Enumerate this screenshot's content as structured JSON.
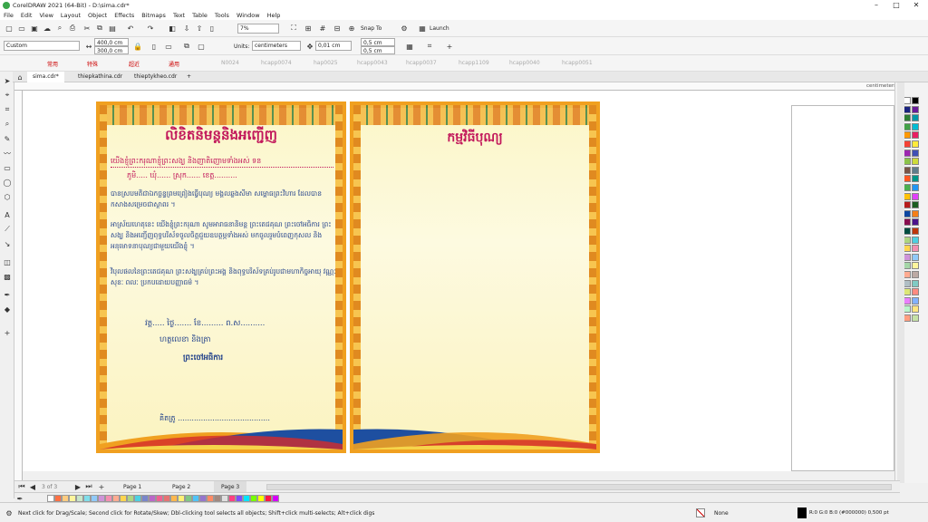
{
  "app": {
    "title": "CorelDRAW 2021 (64-Bit) - D:\\sima.cdr*"
  },
  "menu": [
    "File",
    "Edit",
    "View",
    "Layout",
    "Object",
    "Effects",
    "Bitmaps",
    "Text",
    "Table",
    "Tools",
    "Window",
    "Help"
  ],
  "toolbar": {
    "zoom": "7%",
    "snap_to": "Snap To",
    "launch": "Launch"
  },
  "propertybar": {
    "page_size": "Custom",
    "width": "400,0 cm",
    "height": "300,0 cm",
    "units_label": "Units:",
    "units": "centimeters",
    "nudge": "0,01 cm",
    "dup_x": "0,5 cm",
    "dup_y": "0,5 cm"
  },
  "fontbar": [
    "常用",
    "特殊",
    "超近",
    "通用"
  ],
  "fontbar_dim": [
    "N0024",
    "hcapp0074",
    "hap0025",
    "hcapp0043",
    "hcapp0037",
    "hcapp1109",
    "hcapp0040",
    "hcapp0051"
  ],
  "doc_tabs": [
    {
      "label": "sima.cdr*",
      "active": true
    },
    {
      "label": "thiepkathina.cdr",
      "active": false
    },
    {
      "label": "thieptykheo.cdr",
      "active": false
    }
  ],
  "ruler_unit": "centimeters",
  "left_page": {
    "title": "លិខិតនិមន្តនិងអញ្ជើញ",
    "line1": "យើងខ្ញុំព្រះករុណាខ្ញុំព្រះសង្ឃ និងញាតិញោមទាំងអស់ ទន",
    "line2": "ភូមិ..... ឃុំ...... ស្រុក...... ខេត្ត..........",
    "para1": "បានស្របមតិជាឯកច្ឆន្ទព្រមព្រៀងធ្វើបុណ្យ មង្គលឆ្លងសីមា សម្ពោធព្រះវិហារ ដែលបានកសាងសម្រេចជាស្ថាពរ ។",
    "para2": "អាស្រ័យហេតុនេះ យើងខ្ញុំព្រះករុណា សូមអារាធនានិមន្ត ព្រះតេជគុណ ព្រះចៅអធិការ ព្រះសង្ឃ និងអញ្ជើញពុទ្ធបរិស័ទចូលចិត្តជួយឧបត្ថម្ភទាំងអស់ មកចូលរួមបំពេញកុសល និងអនុមោទនាបុណ្យជាមួយយើងខ្ញុំ ។",
    "para3": "វិបុលផលនៃព្រះតេជគុណ ព្រះសង្ឃគ្រប់ព្រះអង្គ និងពុទ្ធបរិស័ទគ្រប់រូបជាមហាកិច្ចអាយុ វណ្ណៈ សុខៈ ពលៈ ប្រកបដោយបញ្ញាធម៌ ។",
    "date": "វត្ត..... ថ្ងៃ....... ខែ......... ព.ស..........",
    "place": "ហត្ថលេខា និងត្រា",
    "sign": "ព្រះចៅអធិការ",
    "bottom": "គិតត្រូ ........................................"
  },
  "right_page": {
    "title": "កម្មវិធីបុណ្យ"
  },
  "pages": {
    "counter": "3 of 3",
    "tabs": [
      {
        "label": "Page 1",
        "active": false
      },
      {
        "label": "Page 2",
        "active": false
      },
      {
        "label": "Page 3",
        "active": true
      }
    ]
  },
  "status": {
    "hint": "Next click for Drag/Scale; Second click for Rotate/Skew; Dbl-clicking tool selects all objects; Shift+click multi-selects; Alt+click digs",
    "fill": "None",
    "outline": "R:0 G:0 B:0 (#000000)  0,500 pt"
  },
  "colors": {
    "accent": "#3aa64a",
    "border": "#f0a020",
    "title_red": "#c2185b",
    "text_blue": "#1f3f8a"
  },
  "palette_right": [
    "#ffffff",
    "#000000",
    "#1a237e",
    "#6a1b9a",
    "#2e7d32",
    "#0097a7",
    "#43a047",
    "#00bcd4",
    "#ff9800",
    "#e91e63",
    "#f44336",
    "#ffeb3b",
    "#9c27b0",
    "#3f51b5",
    "#8bc34a",
    "#cddc39",
    "#795548",
    "#607d8b",
    "#ff5722",
    "#009688",
    "#4caf50",
    "#2196f3",
    "#ffc107",
    "#e040fb",
    "#b71c1c",
    "#1b5e20",
    "#0d47a1",
    "#f57f17",
    "#880e4f",
    "#4a148c",
    "#004d40",
    "#bf360c",
    "#aed581",
    "#4dd0e1",
    "#ffd54f",
    "#f48fb1",
    "#ce93d8",
    "#90caf9",
    "#a5d6a7",
    "#fff59d",
    "#ffab91",
    "#bcaaa4",
    "#b0bec5",
    "#80cbc4",
    "#dce775",
    "#ff8a80",
    "#ea80fc",
    "#82b1ff",
    "#b9f6ca",
    "#ffe57f",
    "#ff9e80",
    "#c5e1a5"
  ],
  "palette_bottom": [
    "#ffffff",
    "#ff7043",
    "#ffcc80",
    "#fff59d",
    "#c8e6c9",
    "#80deea",
    "#90caf9",
    "#ce93d8",
    "#f48fb1",
    "#ffab91",
    "#ffd54f",
    "#aed581",
    "#4dd0e1",
    "#7986cb",
    "#ba68c8",
    "#f06292",
    "#e57373",
    "#ffb74d",
    "#fff176",
    "#81c784",
    "#4fc3f7",
    "#9575cd",
    "#ff8a65",
    "#a1887f",
    "#e0e0e0",
    "#ff4081",
    "#7c4dff",
    "#00e5ff",
    "#76ff03",
    "#ffff00",
    "#ff1744",
    "#d500f9"
  ]
}
